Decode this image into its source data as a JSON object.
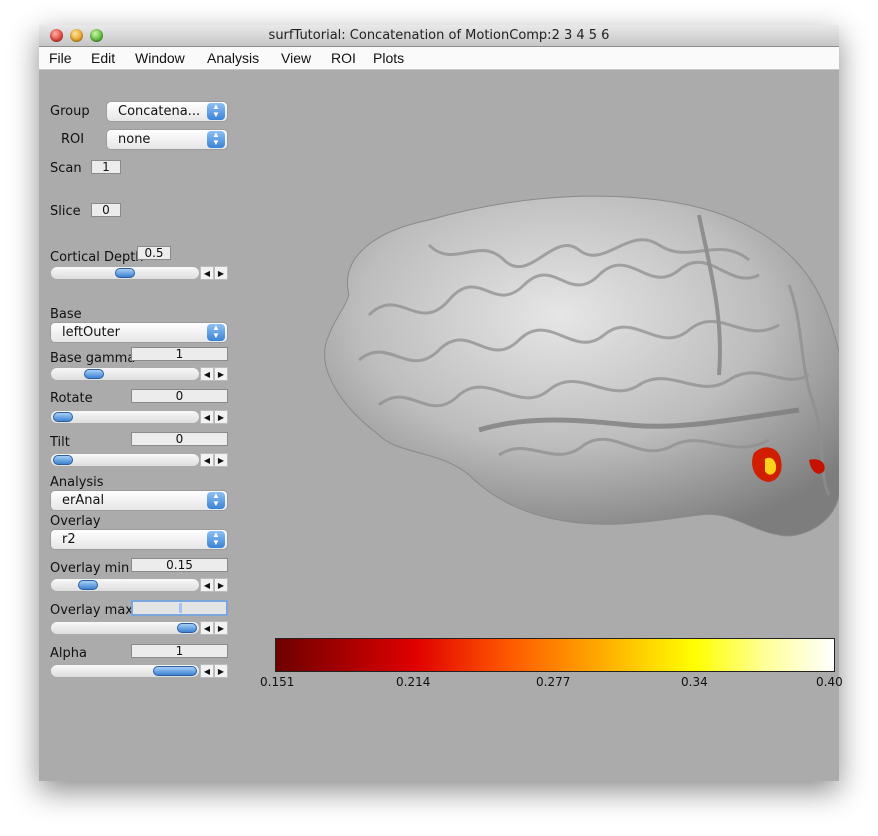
{
  "window": {
    "title": "surfTutorial: Concatenation of MotionComp:2  3  4  5  6"
  },
  "menu": [
    "File",
    "Edit",
    "Window",
    "Analysis",
    "View",
    "ROI",
    "Plots"
  ],
  "controls": {
    "group": {
      "label": "Group",
      "value": "Concatena..."
    },
    "roi": {
      "label": "ROI",
      "value": "none"
    },
    "scan": {
      "label": "Scan",
      "value": "1"
    },
    "slice": {
      "label": "Slice",
      "value": "0"
    },
    "cortical_depth": {
      "label": "Cortical Depth",
      "value": "0.5",
      "slider_fraction": 0.5
    },
    "base": {
      "label": "Base",
      "value": "leftOuter"
    },
    "base_gamma": {
      "label": "Base gamma",
      "value": "1",
      "slider_fraction": 0.25
    },
    "rotate": {
      "label": "Rotate",
      "value": "0",
      "slider_fraction": 0.0
    },
    "tilt": {
      "label": "Tilt",
      "value": "0",
      "slider_fraction": 0.0
    },
    "analysis": {
      "label": "Analysis",
      "value": "erAnal"
    },
    "overlay": {
      "label": "Overlay",
      "value": "r2"
    },
    "overlay_min": {
      "label": "Overlay min",
      "value": "0.15",
      "slider_fraction": 0.2
    },
    "overlay_max": {
      "label": "Overlay max",
      "value": "",
      "slider_fraction": 1.0
    },
    "alpha": {
      "label": "Alpha",
      "value": "1",
      "slider_fraction": 1.0
    }
  },
  "colorbar": {
    "ticks": [
      "0.151",
      "0.214",
      "0.277",
      "0.34",
      "0.40"
    ],
    "colors": [
      "#6e0000",
      "#e00000",
      "#ff5a00",
      "#ffb400",
      "#ffff00",
      "#ffffff"
    ]
  },
  "colors": {
    "window_bg": "#ababab",
    "accent": "#3d82d2"
  }
}
